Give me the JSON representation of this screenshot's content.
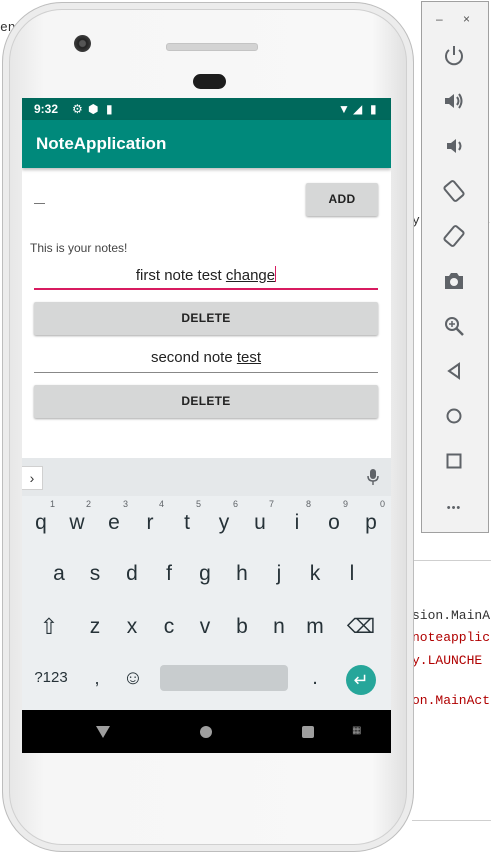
{
  "background": {
    "code_fragments": [
      "en",
      "sion.MainA",
      "noteapplic",
      "y.LAUNCHE",
      "on.MainAct",
      "E",
      "y"
    ],
    "code_colors": {
      "dark": "#333333",
      "red": "#b00000"
    }
  },
  "status_bar": {
    "time": "9:32"
  },
  "app": {
    "title": "NoteApplication",
    "add_button": "ADD",
    "notes_label": "This is your notes!",
    "notes": [
      {
        "plain": "first note test ",
        "underlined": "change",
        "delete_label": "DELETE"
      },
      {
        "plain": "second note ",
        "underlined": "test",
        "delete_label": "DELETE"
      }
    ]
  },
  "keyboard": {
    "row1": [
      {
        "k": "q",
        "h": "1"
      },
      {
        "k": "w",
        "h": "2"
      },
      {
        "k": "e",
        "h": "3"
      },
      {
        "k": "r",
        "h": "4"
      },
      {
        "k": "t",
        "h": "5"
      },
      {
        "k": "y",
        "h": "6"
      },
      {
        "k": "u",
        "h": "7"
      },
      {
        "k": "i",
        "h": "8"
      },
      {
        "k": "o",
        "h": "9"
      },
      {
        "k": "p",
        "h": "0"
      }
    ],
    "row2": [
      "a",
      "s",
      "d",
      "f",
      "g",
      "h",
      "j",
      "k",
      "l"
    ],
    "row3": [
      "z",
      "x",
      "c",
      "v",
      "b",
      "n",
      "m"
    ],
    "shift": "⇧",
    "backspace": "⌫",
    "symbols": "?123",
    "comma": ",",
    "emoji": "☺",
    "period": ".",
    "enter": "↵",
    "chevron": "›"
  },
  "emulator_panel": {
    "minimize": "–",
    "close": "×",
    "more": "•••"
  },
  "colors": {
    "status_bar": "#00695c",
    "app_bar": "#00897b",
    "accent": "#d81b60",
    "enter_key": "#26a69a"
  }
}
